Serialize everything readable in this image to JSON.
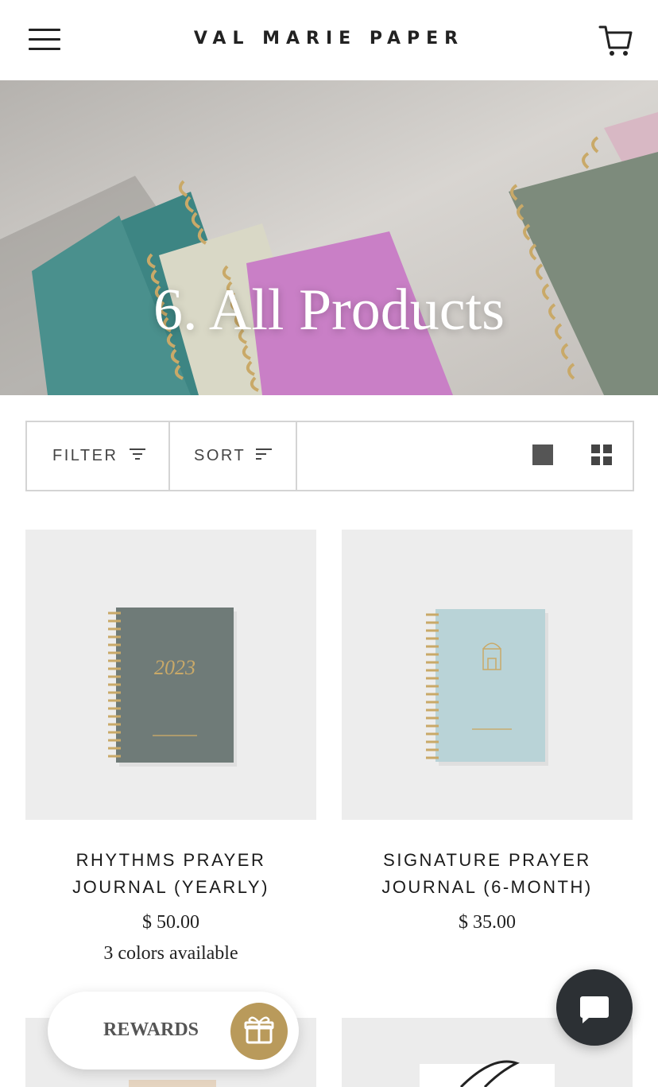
{
  "header": {
    "logo_text": "VAL MARIE PAPER",
    "menu_icon": "hamburger-menu-icon",
    "cart_icon": "shopping-cart-icon"
  },
  "hero": {
    "title": "6. All Products"
  },
  "toolbar": {
    "filter_label": "FILTER",
    "filter_icon": "filter-lines-icon",
    "sort_label": "SORT",
    "sort_icon": "sort-lines-icon",
    "view_single_icon": "single-column-view-icon",
    "view_grid_icon": "grid-view-icon"
  },
  "products": [
    {
      "title": "RHYTHMS PRAYER JOURNAL (YEARLY)",
      "price": "$ 50.00",
      "colors": "3 colors available",
      "cover_text": "2023",
      "cover_color": "#6f7b78"
    },
    {
      "title": "SIGNATURE PRAYER JOURNAL (6-MONTH)",
      "price": "$ 35.00",
      "colors": "",
      "cover_color": "#b9d3d7"
    }
  ],
  "widgets": {
    "rewards_label": "REWARDS",
    "rewards_icon": "gift-icon",
    "chat_icon": "chat-bubble-icon"
  },
  "colors": {
    "accent_gold": "#b99a5b",
    "chat_button": "#2c3034",
    "border": "#d4d4d4"
  }
}
